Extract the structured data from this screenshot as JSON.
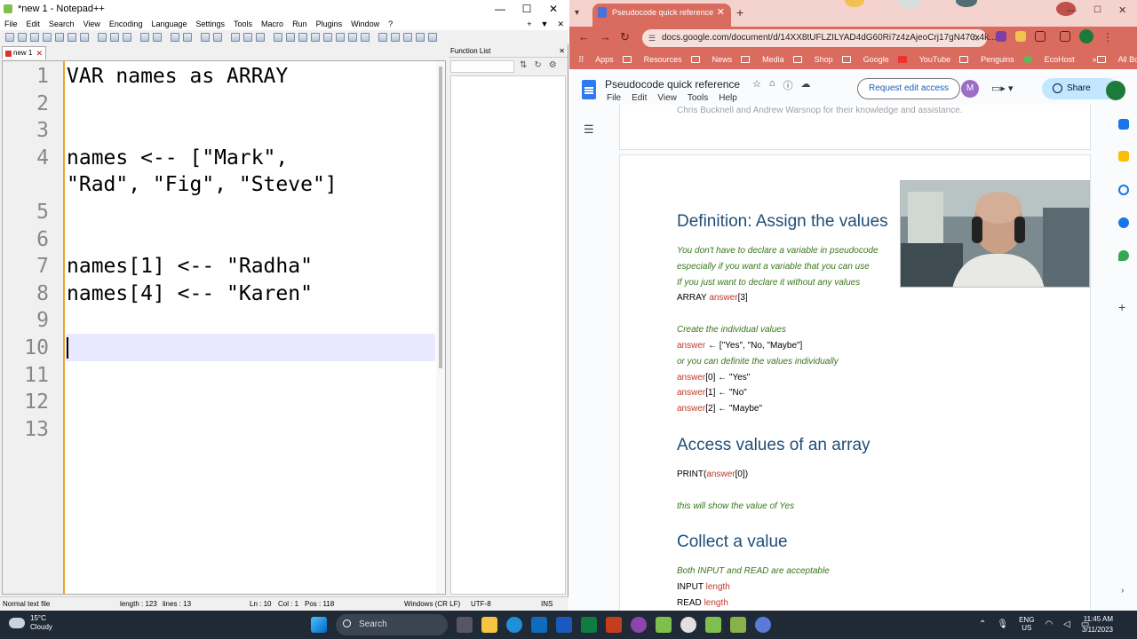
{
  "npp": {
    "title": "*new 1 - Notepad++",
    "win_controls": [
      "—",
      "☐",
      "✕"
    ],
    "menu": [
      "File",
      "Edit",
      "Search",
      "View",
      "Encoding",
      "Language",
      "Settings",
      "Tools",
      "Macro",
      "Run",
      "Plugins",
      "Window",
      "?"
    ],
    "menu_right": [
      "+",
      "▼",
      "✕"
    ],
    "tab_label": "new 1",
    "lines": [
      {
        "num": "1",
        "text": "VAR names as ARRAY"
      },
      {
        "num": "2",
        "text": ""
      },
      {
        "num": "3",
        "text": ""
      },
      {
        "num": "4",
        "text": "names <-- [\"Mark\","
      },
      {
        "num": "",
        "text": "\"Rad\", \"Fig\", \"Steve\"]"
      },
      {
        "num": "5",
        "text": ""
      },
      {
        "num": "6",
        "text": ""
      },
      {
        "num": "7",
        "text": "names[1] <-- \"Radha\""
      },
      {
        "num": "8",
        "text": "names[4] <-- \"Karen\""
      },
      {
        "num": "9",
        "text": ""
      },
      {
        "num": "10",
        "text": ""
      },
      {
        "num": "11",
        "text": ""
      },
      {
        "num": "12",
        "text": ""
      },
      {
        "num": "13",
        "text": ""
      }
    ],
    "function_list": {
      "title": "Function List",
      "close": "✕"
    },
    "status": {
      "type": "Normal text file",
      "length": "length : 123",
      "lines": "lines : 13",
      "ln": "Ln : 10",
      "col": "Col : 1",
      "pos": "Pos : 118",
      "eol": "Windows (CR LF)",
      "enc": "UTF-8",
      "mode": "INS"
    }
  },
  "chrome": {
    "tab_title": "Pseudocode quick reference",
    "tab_close": "✕",
    "new_tab": "+",
    "url": "docs.google.com/document/d/14XX8tUFLZILYAD4dG60Ri7z4zAjeoCrj17gN470x4k...",
    "bookmarks": [
      "Apps",
      "Resources",
      "News",
      "Media",
      "Shop",
      "Google",
      "YouTube",
      "Penguins",
      "EcoHost"
    ],
    "bookmarks_more": "»",
    "all_bookmarks": "All Bookmarks"
  },
  "docs": {
    "title": "Pseudocode quick reference",
    "menu": [
      "File",
      "Edit",
      "View",
      "Tools",
      "Help"
    ],
    "request_edit": "Request edit access",
    "avatar_initial": "M",
    "share": "Share",
    "credit_text": "Chris Bucknell and Andrew Warsnop for their knowledge and assistance.",
    "content": {
      "h1": "Definition: Assign the values",
      "i1": "You don't have to declare a variable in pseudocode",
      "i2": "especially if you want a variable that you can use",
      "i3": "If you just want to declare it without any values",
      "array_kw": "ARRAY ",
      "array_var": "answer",
      "array_rest": "[3]",
      "i4": "Create the individual values",
      "l1_var": "answer",
      "l1_rest": " ← [\"Yes\", \"No, \"Maybe\"]",
      "i5": "or you can definite the values individually",
      "l2_var": "answer",
      "l2_rest": "[0] ← \"Yes\"",
      "l3_var": "answer",
      "l3_rest": "[1] ← \"No\"",
      "l4_var": "answer",
      "l4_rest": "[2] ← \"Maybe\"",
      "h2": "Access values of an array",
      "p1_a": "PRINT(",
      "p1_var": "answer",
      "p1_b": "[0])",
      "i6": "this will show the value of Yes",
      "h3": "Collect a value",
      "i7": "Both INPUT and READ are acceptable",
      "in_kw": "INPUT ",
      "in_var": "length",
      "rd_kw": "READ ",
      "rd_var": "length"
    }
  },
  "taskbar": {
    "temp": "15°C",
    "weather": "Cloudy",
    "search": "Search",
    "lang1": "ENG",
    "lang2": "US",
    "time": "11:45 AM",
    "date": "3/11/2023"
  }
}
